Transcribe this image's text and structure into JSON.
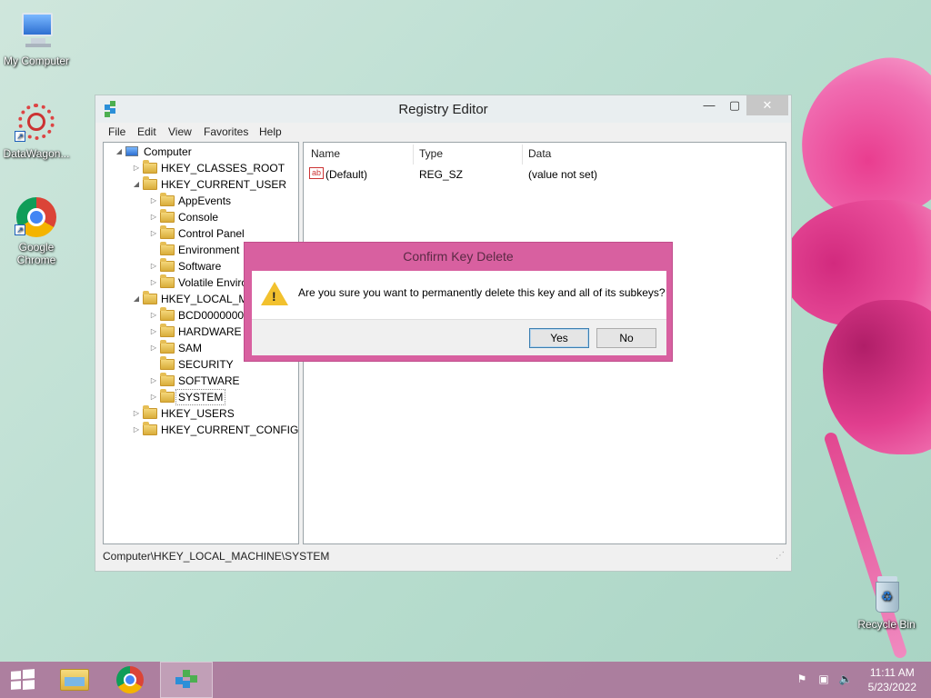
{
  "desktop": {
    "icons": [
      {
        "label": "My Computer",
        "icon": "my-computer-icon"
      },
      {
        "label": "DataWagon...",
        "icon": "datawagon-icon"
      },
      {
        "label": "Google Chrome",
        "icon": "chrome-icon"
      },
      {
        "label": "Recycle Bin",
        "icon": "recycle-bin-icon"
      }
    ]
  },
  "window": {
    "title": "Registry Editor",
    "controls": {
      "minimize": "—",
      "maximize": "▢",
      "close": "✕"
    },
    "menu": [
      "File",
      "Edit",
      "View",
      "Favorites",
      "Help"
    ],
    "tree": [
      {
        "label": "Computer",
        "level": 0,
        "expander": "◢"
      },
      {
        "label": "HKEY_CLASSES_ROOT",
        "level": 1,
        "expander": "▷"
      },
      {
        "label": "HKEY_CURRENT_USER",
        "level": 1,
        "expander": "◢"
      },
      {
        "label": "AppEvents",
        "level": 2,
        "expander": "▷"
      },
      {
        "label": "Console",
        "level": 2,
        "expander": "▷"
      },
      {
        "label": "Control Panel",
        "level": 2,
        "expander": "▷"
      },
      {
        "label": "Environment",
        "level": 2,
        "expander": ""
      },
      {
        "label": "Software",
        "level": 2,
        "expander": "▷"
      },
      {
        "label": "Volatile Enviro",
        "level": 2,
        "expander": "▷"
      },
      {
        "label": "HKEY_LOCAL_MA",
        "level": 1,
        "expander": "◢"
      },
      {
        "label": "BCD00000000",
        "level": 2,
        "expander": "▷"
      },
      {
        "label": "HARDWARE",
        "level": 2,
        "expander": "▷"
      },
      {
        "label": "SAM",
        "level": 2,
        "expander": "▷"
      },
      {
        "label": "SECURITY",
        "level": 2,
        "expander": ""
      },
      {
        "label": "SOFTWARE",
        "level": 2,
        "expander": "▷"
      },
      {
        "label": "SYSTEM",
        "level": 2,
        "expander": "▷",
        "selected": true
      },
      {
        "label": "HKEY_USERS",
        "level": 1,
        "expander": "▷"
      },
      {
        "label": "HKEY_CURRENT_CONFIG",
        "level": 1,
        "expander": "▷"
      }
    ],
    "list": {
      "columns": [
        "Name",
        "Type",
        "Data"
      ],
      "rows": [
        {
          "name": "(Default)",
          "type": "REG_SZ",
          "data": "(value not set)",
          "icon": "ab"
        }
      ]
    },
    "status": "Computer\\HKEY_LOCAL_MACHINE\\SYSTEM"
  },
  "dialog": {
    "title": "Confirm Key Delete",
    "message": "Are you sure you want to permanently delete this key and all of its subkeys?",
    "yes_label": "Yes",
    "no_label": "No",
    "icon": "warning-icon"
  },
  "taskbar": {
    "time": "11:11 AM",
    "date": "5/23/2022"
  },
  "colors": {
    "dialog_frame": "#d860a0",
    "taskbar": "#aa6e96"
  }
}
